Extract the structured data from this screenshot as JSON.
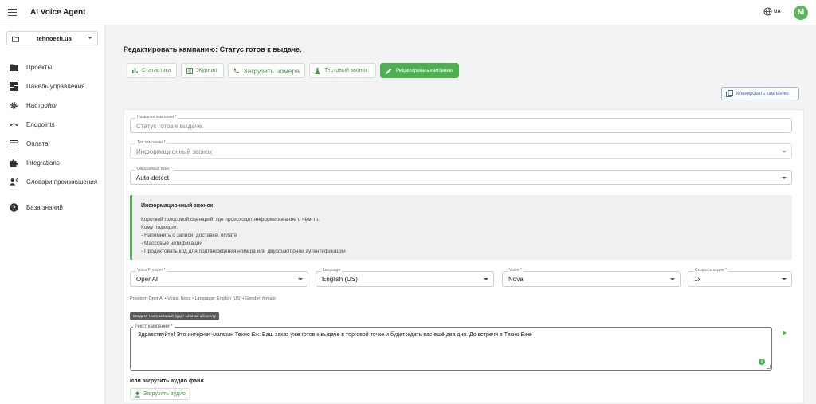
{
  "app": {
    "title": "AI Voice Agent",
    "language_label": "UA",
    "avatar_letter": "M"
  },
  "sidebar": {
    "project": "tehnoezh.ua",
    "items": [
      {
        "label": "Проекты",
        "icon": "folder-icon"
      },
      {
        "label": "Панель управления",
        "icon": "dashboard-icon"
      },
      {
        "label": "Настройки",
        "icon": "gear-icon"
      },
      {
        "label": "Endpoints",
        "icon": "phone-hangup-icon"
      },
      {
        "label": "Оплата",
        "icon": "credit-card-icon"
      },
      {
        "label": "Integrations",
        "icon": "puzzle-icon"
      },
      {
        "label": "Словари произношения",
        "icon": "speaker-person-icon"
      },
      {
        "label": "База знаний",
        "icon": "help-icon"
      }
    ]
  },
  "page": {
    "title": "Редактировать кампанию: Статус готов к выдаче."
  },
  "tabs": [
    {
      "label": "Статистика",
      "icon": "bar-chart-icon",
      "active": false
    },
    {
      "label": "Журнал",
      "icon": "journal-icon",
      "active": false
    },
    {
      "label": "Загрузить номера",
      "icon": "phone-icon",
      "active": false
    },
    {
      "label": "Тестовый звонок",
      "icon": "flask-icon",
      "active": false
    },
    {
      "label": "Редактировать кампанию",
      "icon": "pencil-icon",
      "active": true
    }
  ],
  "clone_button": {
    "label": "Клонировать кампанию"
  },
  "form": {
    "campaign_name": {
      "label": "Название кампании *",
      "value": "Статус готов к выдаче."
    },
    "campaign_type": {
      "label": "Тип кампании *",
      "value": "Информационный звонок"
    },
    "expected_language": {
      "label": "Ожидаемый язык *",
      "value": "Auto-detect"
    },
    "voice_provider": {
      "label": "Voice Provider *",
      "value": "OpenAI"
    },
    "language": {
      "label": "Language",
      "value": "English (US)"
    },
    "voice": {
      "label": "Voice *",
      "value": "Nova"
    },
    "audio_speed": {
      "label": "Скорость аудио *",
      "value": "1x"
    },
    "provider_meta": "Provider: OpenAI • Voice: Nova • Language: English (US) • Gender: female",
    "text_tooltip": "Введите текст, который будет зачитан абоненту",
    "campaign_text": {
      "label": "Текст кампании *",
      "value": "Здравствуйте! Это интернет-магазин Техно Еж. Ваш заказ уже готов к выдаче в торговой точке и будет ждать вас ещё два дня. До встречи в Техно Еже!"
    },
    "upload_title": "Или загрузить аудио файл",
    "upload_button": "Загрузить аудио"
  },
  "info": {
    "title": "Информационный звонок",
    "lines": [
      "Короткий голосовой сценарий, где происходит информирование о чём-то.",
      "Кому подходит:",
      "- Напомнить о записи, доставке, оплате",
      "- Массовые нотификации",
      "- Продиктовать код для подтверждения номера или двухфакторной аутентификации"
    ]
  },
  "colors": {
    "accent": "#4caf50",
    "link_blue": "#3b6fb7"
  }
}
